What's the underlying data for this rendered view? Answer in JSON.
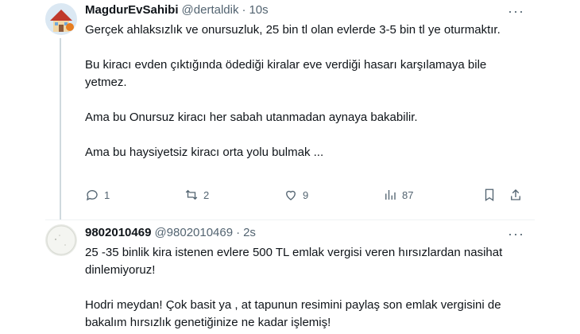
{
  "tweet1": {
    "display_name": "MagdurEvSahibi",
    "handle": "@dertaldik",
    "separator": "·",
    "time": "10s",
    "more_label": "···",
    "text": "Gerçek ahlaksızlık ve onursuzluk, 25 bin tl olan evlerde 3-5 bin tl ye oturmaktır.\n\nBu kiracı evden çıktığında ödediği kiralar eve verdiği hasarı karşılamaya bile yetmez.\n\nAma bu Onursuz kiracı her sabah utanmadan aynaya bakabilir.\n\nAma bu haysiyetsiz kiracı orta yolu bulmak ...",
    "replies": "1",
    "retweets": "2",
    "likes": "9",
    "views": "87"
  },
  "tweet2": {
    "display_name": "9802010469",
    "handle": "@9802010469",
    "separator": "·",
    "time": "2s",
    "more_label": "···",
    "text": "25 -35 binlik kira istenen evlere 500 TL emlak vergisi veren hırsızlardan nasihat dinlemiyoruz!\n\nHodri meydan! Çok basit ya , at tapunun resimini paylaş son emlak vergisini de bakalım hırsızlık genetiğinize ne kadar işlemiş!"
  },
  "colors": {
    "text": "#0f1419",
    "secondary": "#536471",
    "divider": "#eff3f4"
  }
}
